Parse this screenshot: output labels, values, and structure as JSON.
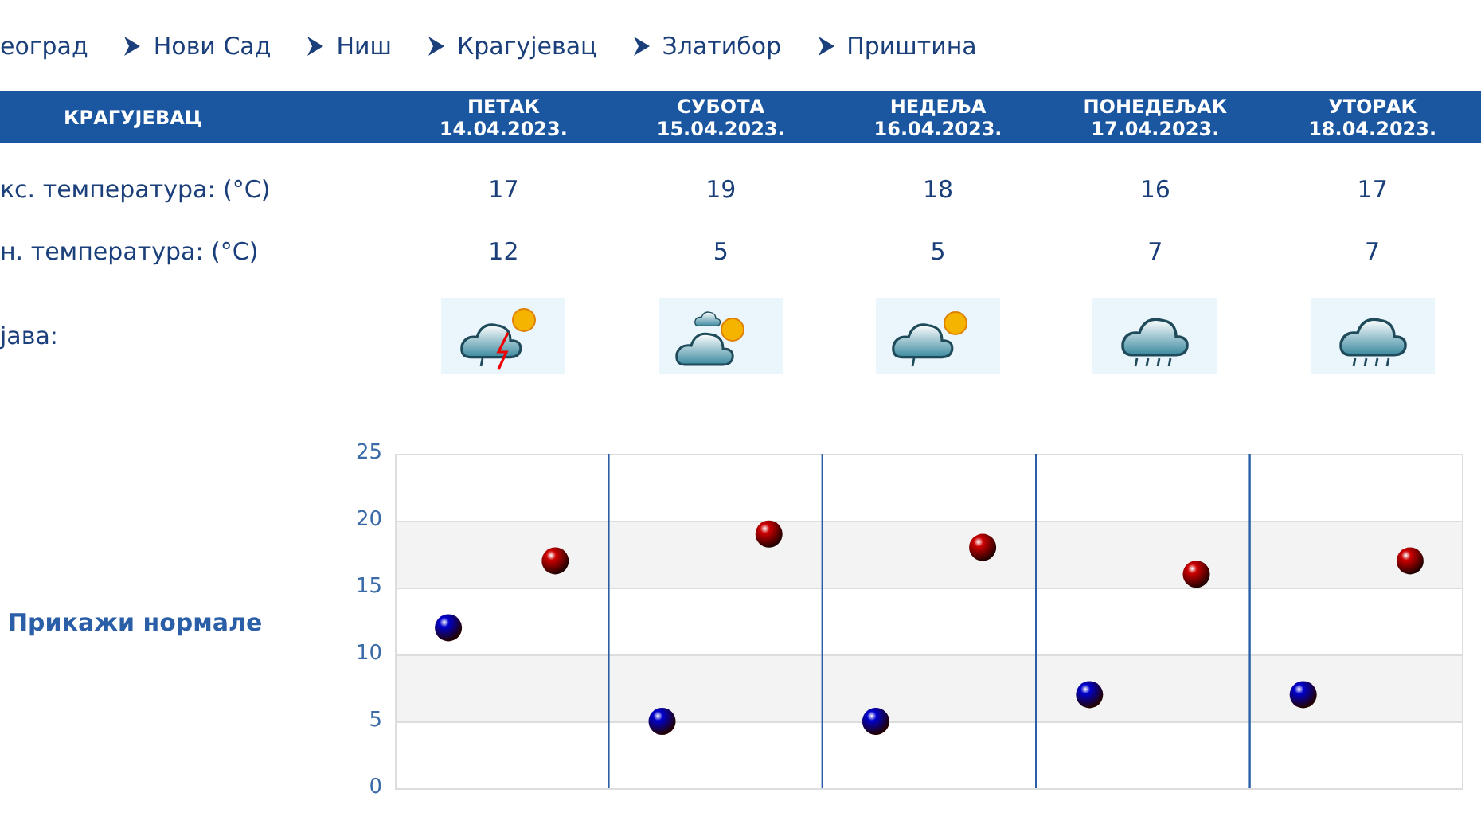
{
  "nav": [
    {
      "label": "еоград",
      "arrow": false
    },
    {
      "label": "Нови Сад",
      "arrow": true
    },
    {
      "label": "Ниш",
      "arrow": true
    },
    {
      "label": "Крагујевац",
      "arrow": true
    },
    {
      "label": "Златибор",
      "arrow": true
    },
    {
      "label": "Приштина",
      "arrow": true
    }
  ],
  "table": {
    "city": "КРАГУЈЕВАЦ",
    "days": [
      {
        "day": "ПЕТАК",
        "date": "14.04.2023."
      },
      {
        "day": "СУБОТА",
        "date": "15.04.2023."
      },
      {
        "day": "НЕДЕЉА",
        "date": "16.04.2023."
      },
      {
        "day": "ПОНЕДЕЉАК",
        "date": "17.04.2023."
      },
      {
        "day": "УТОРАК",
        "date": "18.04.2023."
      }
    ],
    "rows": [
      {
        "label": "кс. температура: (°C)",
        "values": [
          "17",
          "19",
          "18",
          "16",
          "17"
        ]
      },
      {
        "label": "н. температура: (°C)",
        "values": [
          "12",
          "5",
          "5",
          "7",
          "7"
        ]
      }
    ],
    "weather": {
      "label": "јава:",
      "icons": [
        {
          "kind": "storm"
        },
        {
          "kind": "sun-cloud"
        },
        {
          "kind": "sun-cloud-drizzle"
        },
        {
          "kind": "rain"
        },
        {
          "kind": "rain"
        }
      ]
    }
  },
  "normals_link": "Прикажи нормале",
  "chart_data": {
    "type": "scatter",
    "grid": true,
    "ylim": [
      0,
      25
    ],
    "yticks": [
      0,
      5,
      10,
      15,
      20,
      25
    ],
    "series": [
      {
        "color": "#0000cc",
        "values": [
          12,
          5,
          5,
          7,
          7
        ]
      },
      {
        "color": "#cc0000",
        "values": [
          17,
          19,
          18,
          16,
          17
        ]
      }
    ]
  }
}
